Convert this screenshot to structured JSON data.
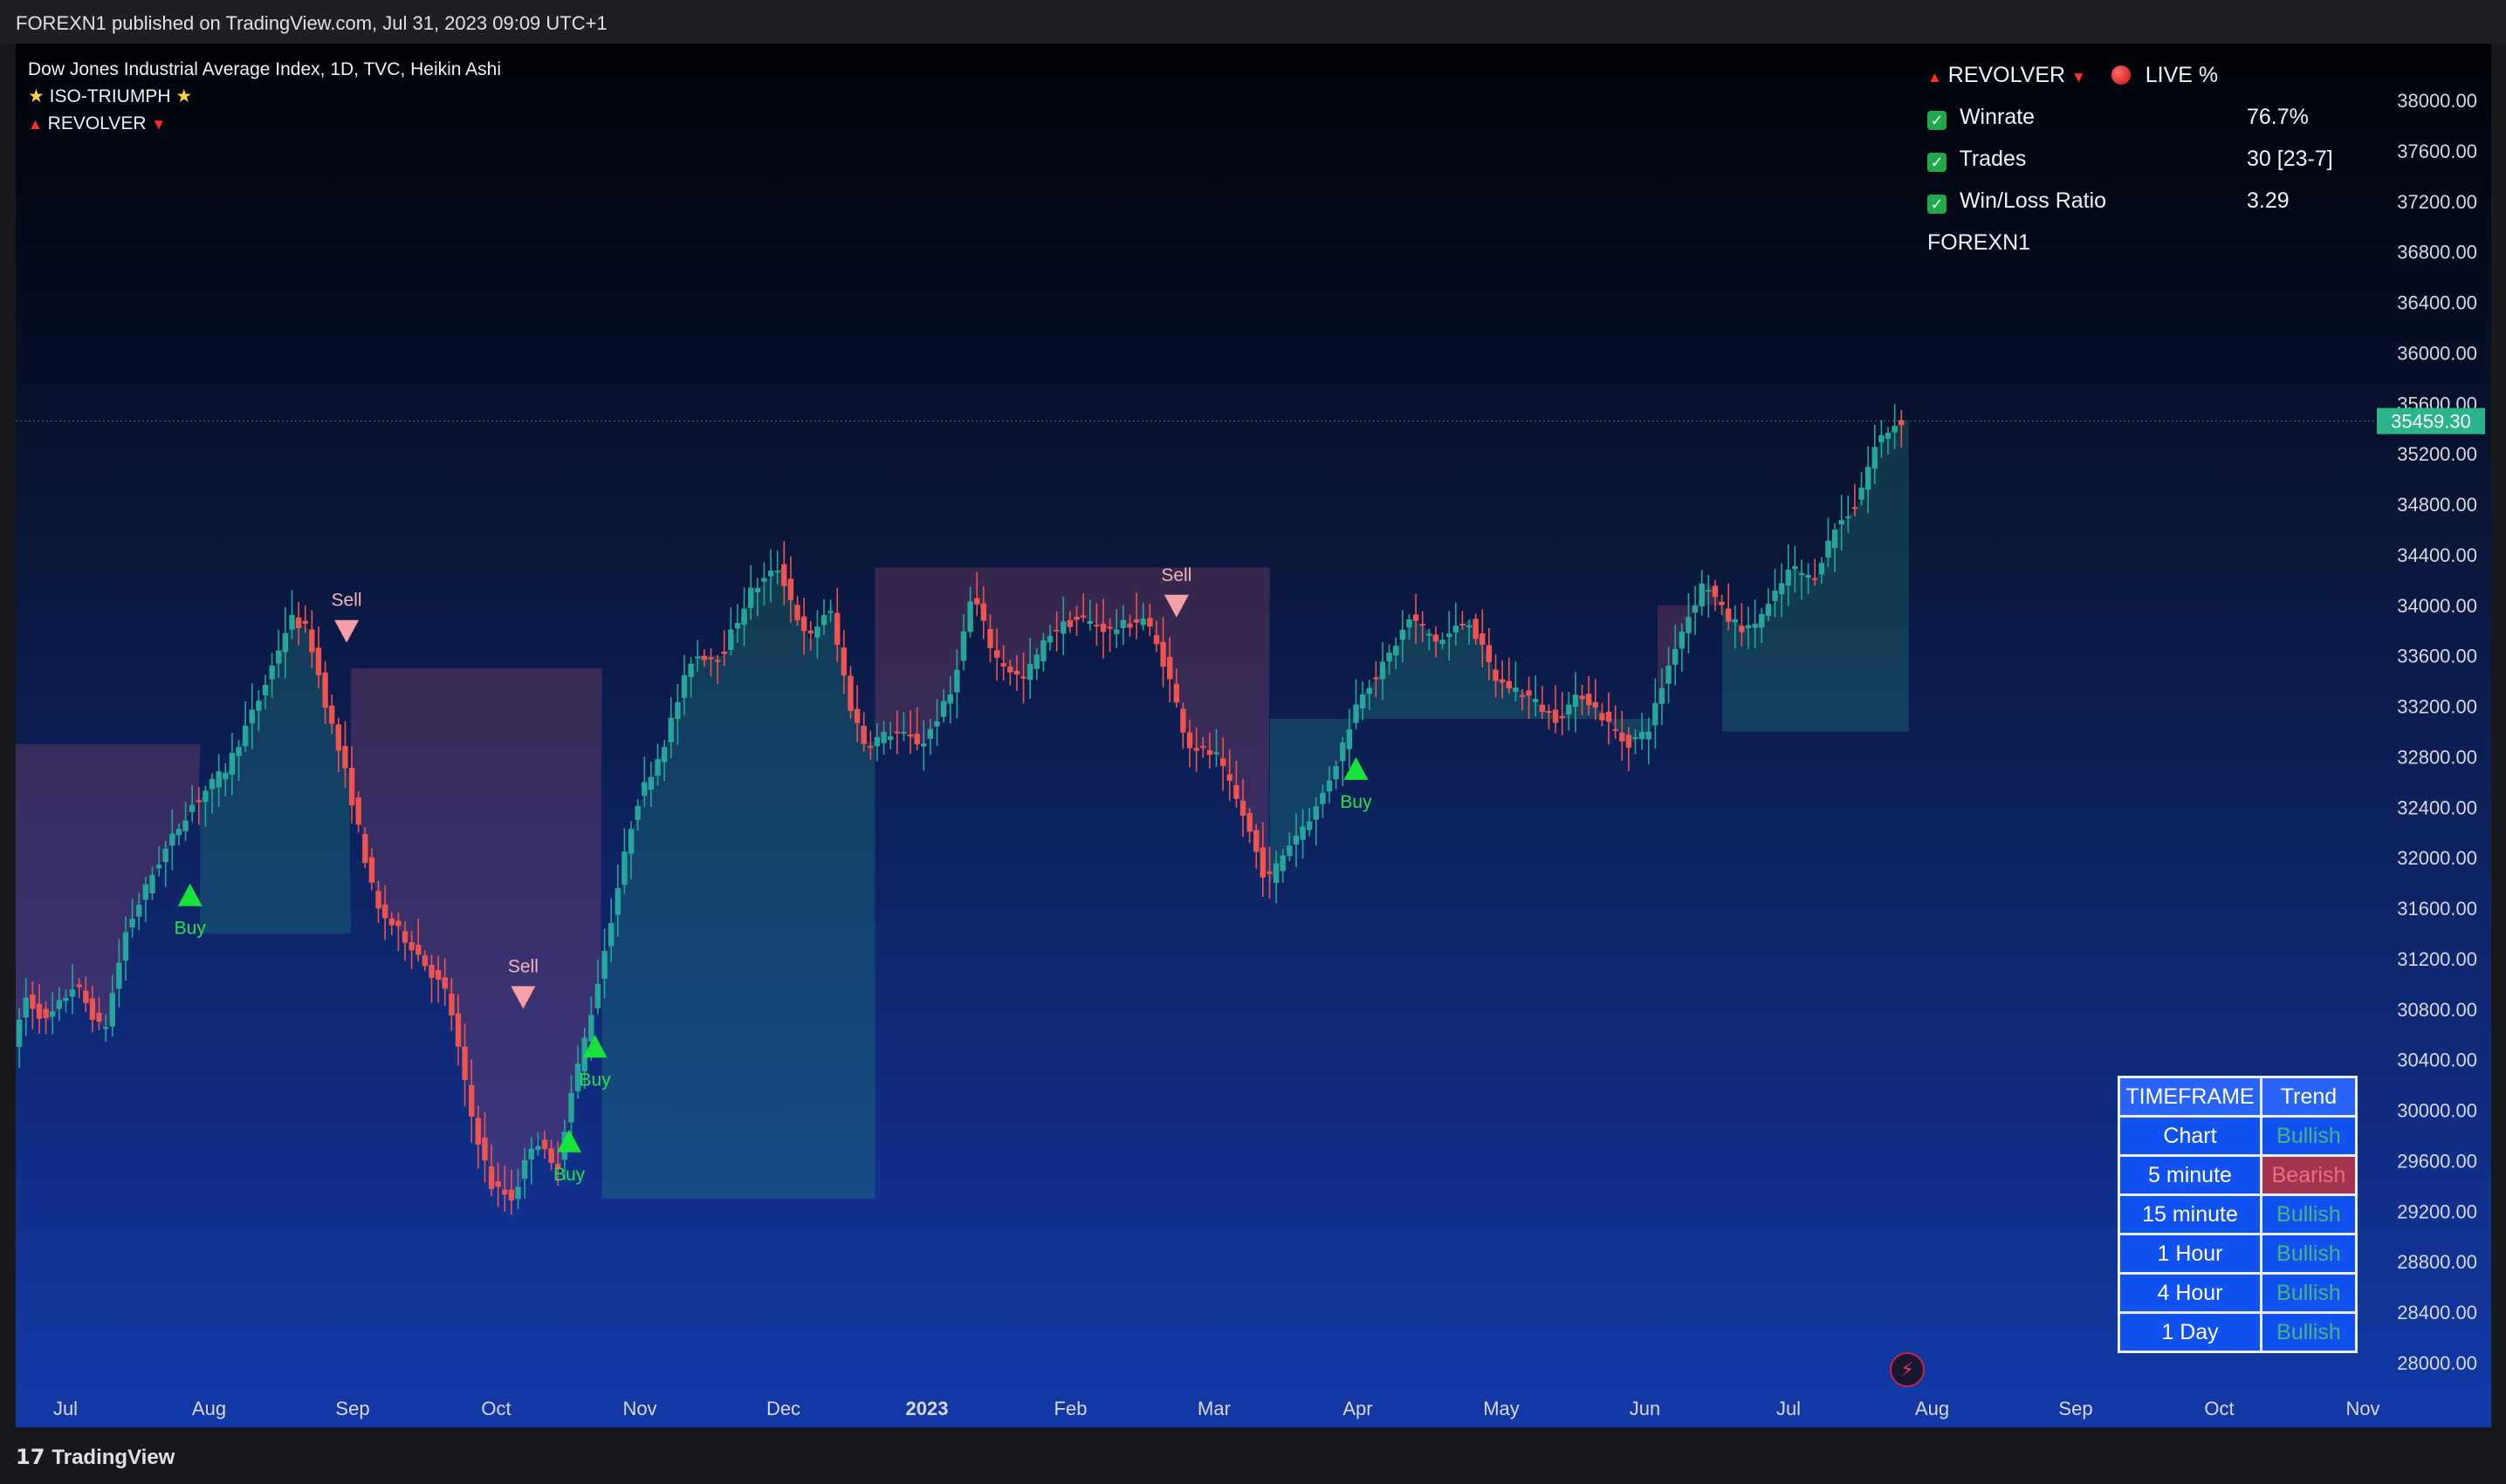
{
  "publish_line": "FOREXN1 published on TradingView.com, Jul 31, 2023 09:09 UTC+1",
  "legend": {
    "line1": "Dow Jones Industrial Average Index, 1D, TVC, Heikin Ashi",
    "line2": "ISO-TRIUMPH",
    "line3": "REVOLVER"
  },
  "stats": {
    "title": "REVOLVER",
    "live": "LIVE %",
    "rows": [
      {
        "label": "Winrate",
        "value": "76.7%"
      },
      {
        "label": "Trades",
        "value": "30 [23-7]"
      },
      {
        "label": "Win/Loss Ratio",
        "value": "3.29"
      }
    ],
    "author": "FOREXN1"
  },
  "trend_table": {
    "headers": [
      "TIMEFRAME",
      "Trend"
    ],
    "rows": [
      [
        "Chart",
        "Bullish"
      ],
      [
        "5 minute",
        "Bearish"
      ],
      [
        "15 minute",
        "Bullish"
      ],
      [
        "1 Hour",
        "Bullish"
      ],
      [
        "4 Hour",
        "Bullish"
      ],
      [
        "1 Day",
        "Bullish"
      ]
    ]
  },
  "brand": "TradingView",
  "icons": {
    "check": "checkmark-icon",
    "live": "red-dot-icon",
    "bolt": "lightning-icon",
    "logo": "tradingview-logo-icon"
  },
  "colors": {
    "bull": "#26a69a",
    "bear": "#ef5350",
    "buy": "#18e33d",
    "sell": "#f5a0a8",
    "price_tag": "#2bb38c"
  },
  "chart_data": {
    "type": "candlestick",
    "title": "Dow Jones Industrial Average Index, 1D, TVC, Heikin Ashi",
    "x_tick_labels": [
      "Jul",
      "Aug",
      "Sep",
      "Oct",
      "Nov",
      "Dec",
      "2023",
      "Feb",
      "Mar",
      "Apr",
      "May",
      "Jun",
      "Jul",
      "Aug",
      "Sep",
      "Oct",
      "Nov"
    ],
    "x_tick_months": [
      0,
      1,
      2,
      3,
      4,
      5,
      6,
      7,
      8,
      9,
      10,
      11,
      12,
      13,
      14,
      15,
      16
    ],
    "y_tick_labels": [
      "38000.00",
      "37600.00",
      "37200.00",
      "36800.00",
      "36400.00",
      "36000.00",
      "35600.00",
      "35200.00",
      "34800.00",
      "34400.00",
      "34000.00",
      "33600.00",
      "33200.00",
      "32800.00",
      "32400.00",
      "32000.00",
      "31600.00",
      "31200.00",
      "30800.00",
      "30400.00",
      "30000.00",
      "29600.00",
      "29200.00",
      "28800.00",
      "28400.00",
      "28000.00"
    ],
    "ylim": [
      27950,
      38300
    ],
    "last_price": "35459.30",
    "anchors_month_price": [
      [
        -0.35,
        30400
      ],
      [
        -0.25,
        30900
      ],
      [
        -0.1,
        30700
      ],
      [
        0.1,
        31000
      ],
      [
        0.3,
        30600
      ],
      [
        0.45,
        31400
      ],
      [
        0.65,
        31900
      ],
      [
        0.9,
        32400
      ],
      [
        1.15,
        32700
      ],
      [
        1.4,
        33300
      ],
      [
        1.6,
        33900
      ],
      [
        1.72,
        33800
      ],
      [
        1.85,
        33200
      ],
      [
        2.0,
        32600
      ],
      [
        2.2,
        31600
      ],
      [
        2.45,
        31300
      ],
      [
        2.7,
        30900
      ],
      [
        2.85,
        30000
      ],
      [
        3.0,
        29400
      ],
      [
        3.15,
        29300
      ],
      [
        3.3,
        29800
      ],
      [
        3.45,
        29500
      ],
      [
        3.55,
        30100
      ],
      [
        3.7,
        30800
      ],
      [
        3.85,
        31600
      ],
      [
        4.0,
        32400
      ],
      [
        4.2,
        32900
      ],
      [
        4.4,
        33600
      ],
      [
        4.6,
        33600
      ],
      [
        4.8,
        34100
      ],
      [
        5.0,
        34300
      ],
      [
        5.2,
        33700
      ],
      [
        5.35,
        34000
      ],
      [
        5.5,
        33200
      ],
      [
        5.6,
        32900
      ],
      [
        5.8,
        33000
      ],
      [
        6.0,
        32900
      ],
      [
        6.2,
        33300
      ],
      [
        6.35,
        34100
      ],
      [
        6.5,
        33600
      ],
      [
        6.7,
        33400
      ],
      [
        6.9,
        33800
      ],
      [
        7.1,
        33900
      ],
      [
        7.3,
        33800
      ],
      [
        7.55,
        33900
      ],
      [
        7.7,
        33500
      ],
      [
        7.85,
        32900
      ],
      [
        8.05,
        32800
      ],
      [
        8.25,
        32300
      ],
      [
        8.4,
        31800
      ],
      [
        8.55,
        32100
      ],
      [
        8.75,
        32400
      ],
      [
        8.9,
        32800
      ],
      [
        9.05,
        33300
      ],
      [
        9.2,
        33500
      ],
      [
        9.4,
        33900
      ],
      [
        9.6,
        33700
      ],
      [
        9.8,
        33900
      ],
      [
        10.0,
        33400
      ],
      [
        10.2,
        33300
      ],
      [
        10.4,
        33100
      ],
      [
        10.6,
        33300
      ],
      [
        10.75,
        33100
      ],
      [
        10.9,
        32900
      ],
      [
        11.05,
        33000
      ],
      [
        11.25,
        33700
      ],
      [
        11.45,
        34200
      ],
      [
        11.6,
        33900
      ],
      [
        11.75,
        33800
      ],
      [
        11.9,
        34000
      ],
      [
        12.05,
        34300
      ],
      [
        12.2,
        34200
      ],
      [
        12.35,
        34600
      ],
      [
        12.5,
        34800
      ],
      [
        12.65,
        35300
      ],
      [
        12.8,
        35460
      ]
    ],
    "signals": [
      {
        "label": "Buy",
        "month": 0.88,
        "price": 31700
      },
      {
        "label": "Sell",
        "month": 1.97,
        "price": 33800
      },
      {
        "label": "Sell",
        "month": 3.2,
        "price": 30900
      },
      {
        "label": "Buy",
        "month": 3.52,
        "price": 29750
      },
      {
        "label": "Buy",
        "month": 3.7,
        "price": 30500
      },
      {
        "label": "Sell",
        "month": 7.75,
        "price": 34000
      },
      {
        "label": "Buy",
        "month": 9.0,
        "price": 32700
      }
    ],
    "bands": [
      {
        "kind": "bear",
        "from": -0.4,
        "to": 0.95,
        "level": 32900
      },
      {
        "kind": "bear",
        "from": 2.0,
        "to": 3.75,
        "level": 33500
      },
      {
        "kind": "bear",
        "from": 5.65,
        "to": 8.4,
        "level": 34300
      },
      {
        "kind": "bear",
        "from": 11.1,
        "to": 11.55,
        "level": 34000
      },
      {
        "kind": "bull",
        "from": 0.95,
        "to": 2.0,
        "level": 31400
      },
      {
        "kind": "bull",
        "from": 3.75,
        "to": 5.65,
        "level": 29300
      },
      {
        "kind": "bull",
        "from": 8.4,
        "to": 11.1,
        "level": 33100
      },
      {
        "kind": "bull",
        "from": 11.55,
        "to": 12.85,
        "level": 33000
      }
    ]
  }
}
